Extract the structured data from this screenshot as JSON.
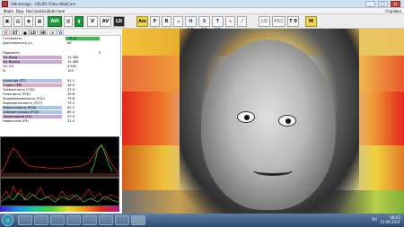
{
  "window": {
    "title": "Vibraimage - VELDO Video WebCam",
    "controls": [
      "_",
      "□",
      "×"
    ]
  },
  "menu": {
    "items": [
      "Файл",
      "Вид",
      "Настройки",
      "Действия"
    ],
    "help": "Справка"
  },
  "toolbar": {
    "buttons": [
      "AVI",
      "V",
      "AV",
      "LD",
      "Am",
      "F",
      "R",
      "H 10",
      "S 10",
      "T 10",
      "LD",
      "REC",
      "T 0",
      "M"
    ]
  },
  "subbar": {
    "buttons": [
      "VI",
      "ST",
      "LD",
      "SR",
      "Vi"
    ]
  },
  "panel": {
    "readiness_label": "Готовность",
    "readiness_value": "75 %",
    "readiness_level": 0.75,
    "duration_label": "Длительность (с)",
    "duration_value": "60",
    "param_header": "Параметр",
    "param_unit_header": "S",
    "params": [
      {
        "label": "Ч/с Вход",
        "value": "15.385"
      },
      {
        "label": "Ч/с Выход",
        "value": "15.385"
      },
      {
        "label": "Ч/с ОО",
        "value": "4.932"
      },
      {
        "label": "N",
        "value": "100"
      }
    ],
    "emotions": [
      {
        "label": "Агрессия (P7)",
        "value": "61.5"
      },
      {
        "label": "Стресс (P8)",
        "value": "18.5"
      },
      {
        "label": "Тревожность (F3X)",
        "value": "37.9"
      },
      {
        "label": "Опасность (P16)",
        "value": "39.8"
      },
      {
        "label": "Уравновешенность (P10)",
        "value": "79.8"
      },
      {
        "label": "Харизматичность (P17)",
        "value": "79.3"
      },
      {
        "label": "Энергичность (P18)",
        "value": "85.5"
      },
      {
        "label": "Саморегуляция (P16)",
        "value": "85.5"
      },
      {
        "label": "Торможение (F4)",
        "value": "25.9"
      },
      {
        "label": "Невротизм (F9)",
        "value": "31.0"
      }
    ]
  },
  "taskbar": {
    "lang": "RU",
    "time": "08:03",
    "date": "15.09.2011"
  },
  "colors": {
    "accent_green": "#3dbb4a",
    "graph_red": "#e3281a",
    "graph_green": "#2fd13a"
  }
}
